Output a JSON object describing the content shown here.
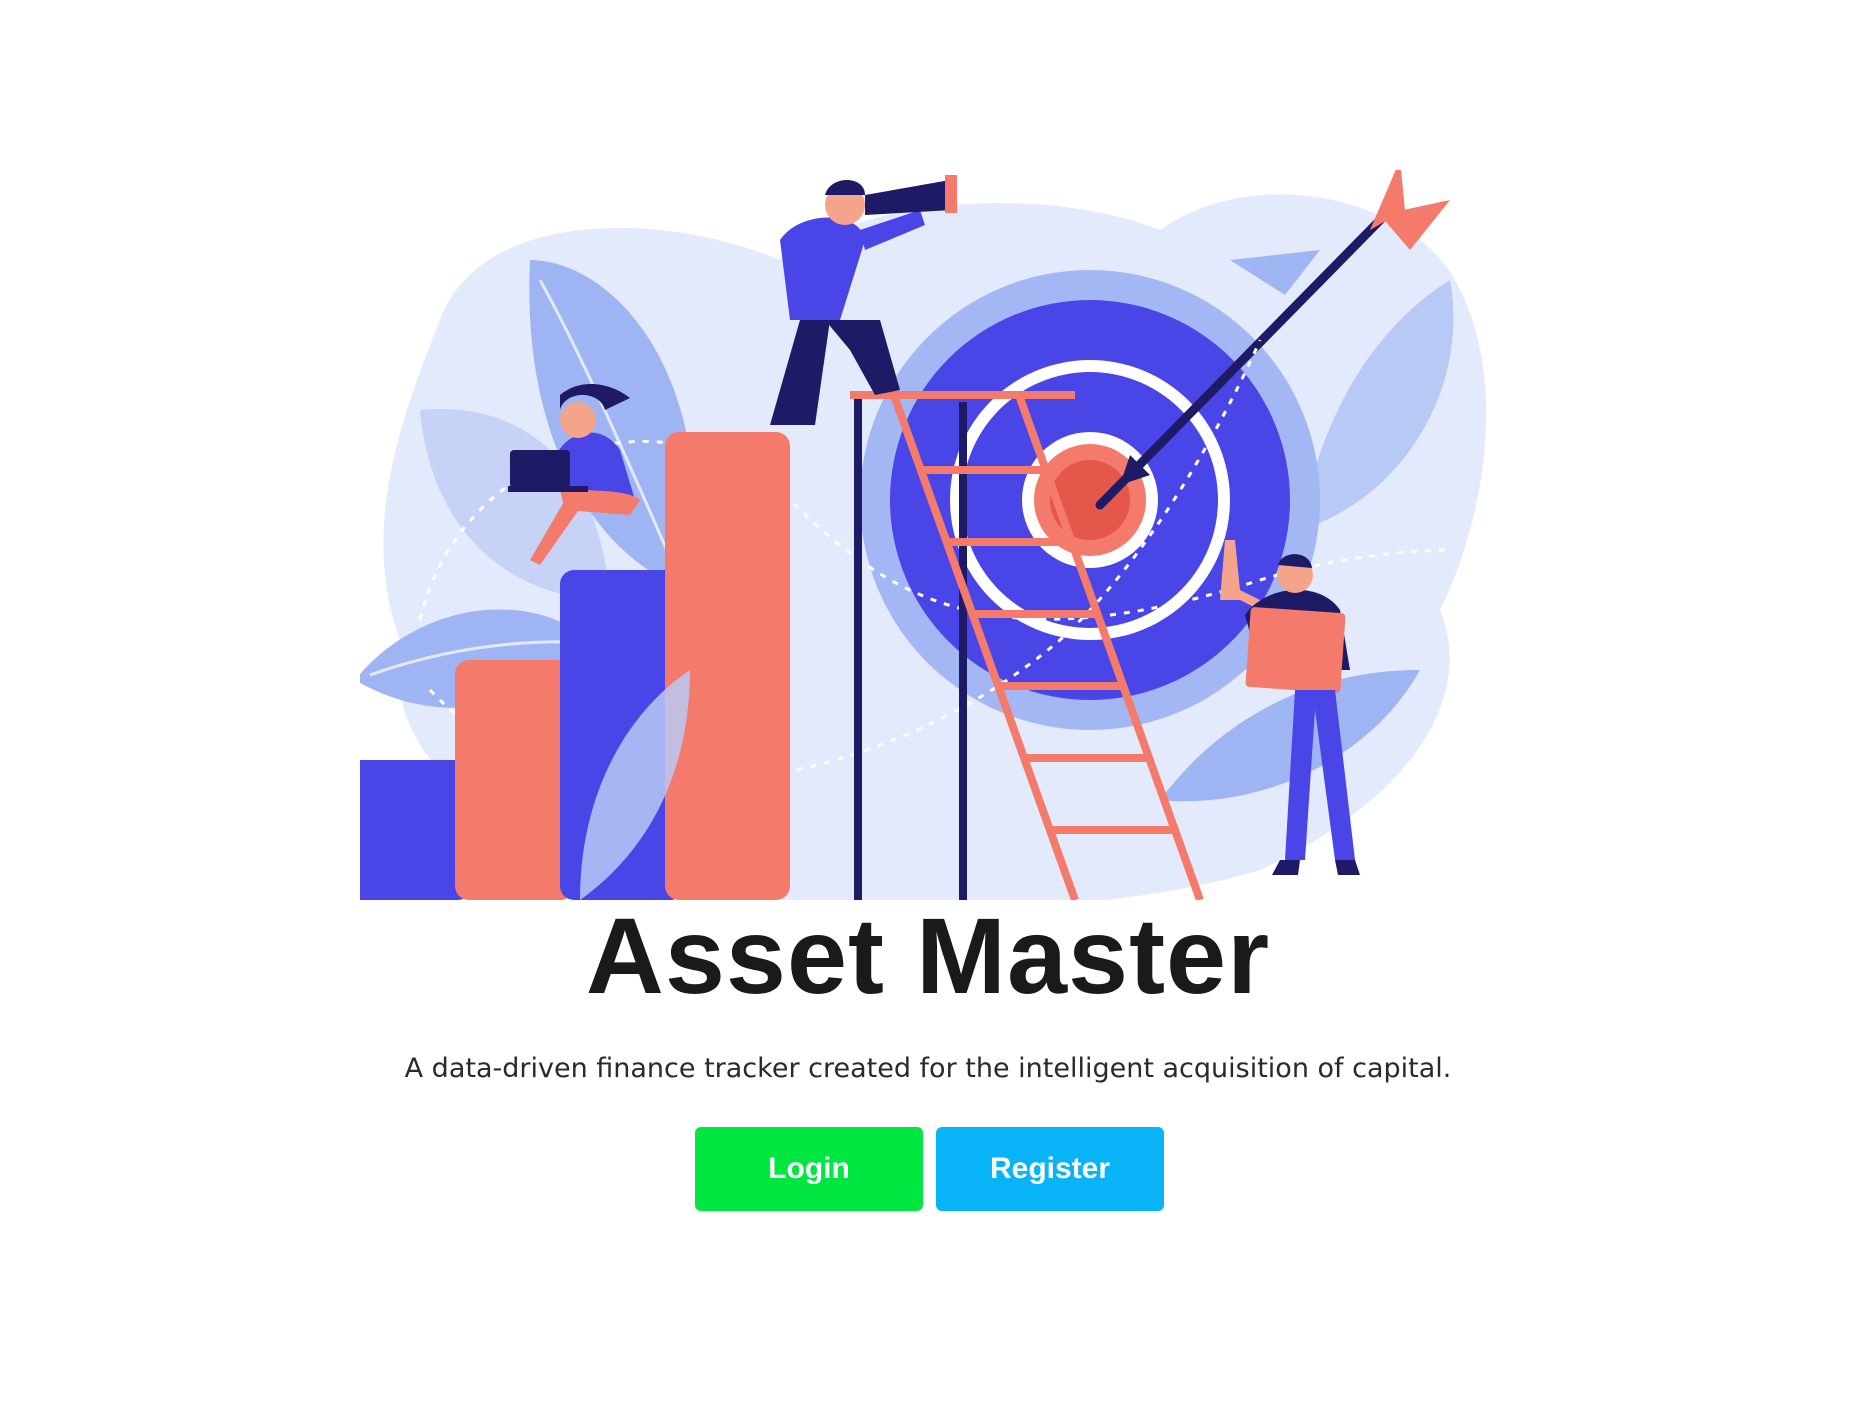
{
  "app": {
    "title": "Asset Master",
    "tagline": "A data-driven finance tracker created for the intelligent acquisition of capital."
  },
  "actions": {
    "login_label": "Login",
    "register_label": "Register"
  },
  "illustration": {
    "icon": "growth-target-illustration"
  },
  "colors": {
    "login_button": "#00e640",
    "register_button": "#08b3f7",
    "title_text": "#1a1a1a",
    "illustration_blue": "#4a45e6",
    "illustration_coral": "#f47a6b",
    "illustration_light": "#dde6fb"
  }
}
